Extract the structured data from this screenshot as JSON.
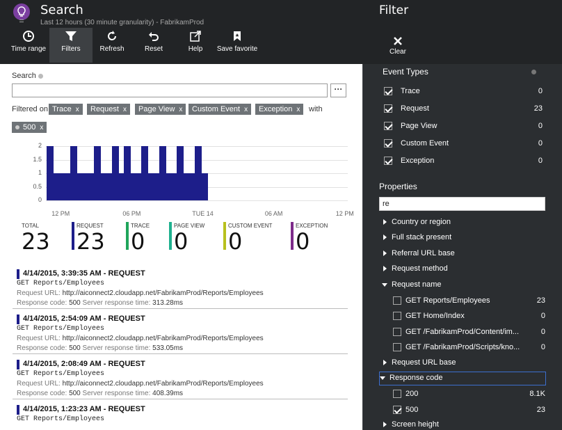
{
  "header": {
    "title": "Search",
    "subtitle": "Last 12 hours (30 minute granularity) - FabrikamProd",
    "toolbar": [
      {
        "id": "time-range",
        "label": "Time range",
        "icon": "clock-icon",
        "active": false
      },
      {
        "id": "filters",
        "label": "Filters",
        "icon": "funnel-icon",
        "active": true
      },
      {
        "id": "refresh",
        "label": "Refresh",
        "icon": "refresh-icon",
        "active": false
      },
      {
        "id": "reset",
        "label": "Reset",
        "icon": "undo-icon",
        "active": false
      },
      {
        "id": "help",
        "label": "Help",
        "icon": "external-link-icon",
        "active": false
      },
      {
        "id": "save-favorite",
        "label": "Save favorite",
        "icon": "bookmark-icon",
        "active": false
      }
    ]
  },
  "search": {
    "label": "Search",
    "value": "",
    "more_label": "···",
    "filtered_on_label": "Filtered on",
    "with_label": "with",
    "chips": [
      "Trace",
      "Request",
      "Page View",
      "Custom Event",
      "Exception"
    ],
    "code_chip": "500",
    "chip_close": "x"
  },
  "chart_data": {
    "type": "bar",
    "y_ticks": [
      "2",
      "1.5",
      "1",
      "0.5",
      "0"
    ],
    "ylim": [
      0,
      2
    ],
    "values": [
      2,
      1,
      1,
      1,
      2,
      1,
      1,
      1,
      2,
      1,
      1,
      2,
      1,
      2,
      1,
      1,
      2,
      1,
      1,
      2,
      1,
      1,
      2,
      1,
      1,
      2,
      1
    ],
    "x_ticks": [
      {
        "label": "12 PM",
        "index": 2
      },
      {
        "label": "06 PM",
        "index": 14
      },
      {
        "label": "TUE 14",
        "index": 26
      },
      {
        "label": "06 AM",
        "index": 38
      },
      {
        "label": "12 PM",
        "index": 50
      }
    ],
    "slots": 51,
    "color": "#1d1e8a"
  },
  "stats": [
    {
      "label": "TOTAL",
      "value": "23",
      "color": ""
    },
    {
      "label": "REQUEST",
      "value": "23",
      "color": "#1d1e8a"
    },
    {
      "label": "TRACE",
      "value": "0",
      "color": "#1fa55b"
    },
    {
      "label": "PAGE VIEW",
      "value": "0",
      "color": "#1fb18f"
    },
    {
      "label": "CUSTOM EVENT",
      "value": "0",
      "color": "#b8c01e"
    },
    {
      "label": "EXCEPTION",
      "value": "0",
      "color": "#7d2b8a"
    }
  ],
  "results": [
    {
      "title": "4/14/2015, 3:39:35 AM - REQUEST",
      "line2": "GET Reports/Employees",
      "url_label": "Request URL:",
      "url": "http://aiconnect2.cloudapp.net/FabrikamProd/Reports/Employees",
      "code_label": "Response code:",
      "code": "500",
      "time_label": "Server response time:",
      "time": "313.28ms"
    },
    {
      "title": "4/14/2015, 2:54:09 AM - REQUEST",
      "line2": "GET Reports/Employees",
      "url_label": "Request URL:",
      "url": "http://aiconnect2.cloudapp.net/FabrikamProd/Reports/Employees",
      "code_label": "Response code:",
      "code": "500",
      "time_label": "Server response time:",
      "time": "533.05ms"
    },
    {
      "title": "4/14/2015, 2:08:49 AM - REQUEST",
      "line2": "GET Reports/Employees",
      "url_label": "Request URL:",
      "url": "http://aiconnect2.cloudapp.net/FabrikamProd/Reports/Employees",
      "code_label": "Response code:",
      "code": "500",
      "time_label": "Server response time:",
      "time": "408.39ms"
    },
    {
      "title": "4/14/2015, 1:23:23 AM - REQUEST",
      "line2": "GET Reports/Employees",
      "url_label": "",
      "url": "",
      "code_label": "",
      "code": "",
      "time_label": "",
      "time": ""
    }
  ],
  "filter_panel": {
    "title": "Filter",
    "clear_label": "Clear",
    "event_types_heading": "Event Types",
    "event_types": [
      {
        "label": "Trace",
        "count": "0",
        "checked": true
      },
      {
        "label": "Request",
        "count": "23",
        "checked": true
      },
      {
        "label": "Page View",
        "count": "0",
        "checked": true
      },
      {
        "label": "Custom Event",
        "count": "0",
        "checked": true
      },
      {
        "label": "Exception",
        "count": "0",
        "checked": true
      }
    ],
    "properties_heading": "Properties",
    "properties_search": "re",
    "properties": [
      {
        "label": "Country or region",
        "open": false
      },
      {
        "label": "Full stack present",
        "open": false
      },
      {
        "label": "Referral URL base",
        "open": false
      },
      {
        "label": "Request method",
        "open": false
      },
      {
        "label": "Request name",
        "open": true,
        "values": [
          {
            "label": "GET Reports/Employees",
            "count": "23",
            "checked": false
          },
          {
            "label": "GET Home/Index",
            "count": "0",
            "checked": false
          },
          {
            "label": "GET /FabrikamProd/Content/im...",
            "count": "0",
            "checked": false
          },
          {
            "label": "GET /FabrikamProd/Scripts/kno...",
            "count": "0",
            "checked": false
          }
        ]
      },
      {
        "label": "Request URL base",
        "open": false
      },
      {
        "label": "Response code",
        "open": true,
        "selected": true,
        "values": [
          {
            "label": "200",
            "count": "8.1K",
            "checked": false
          },
          {
            "label": "500",
            "count": "23",
            "checked": true
          }
        ]
      },
      {
        "label": "Screen height",
        "open": false
      }
    ]
  }
}
